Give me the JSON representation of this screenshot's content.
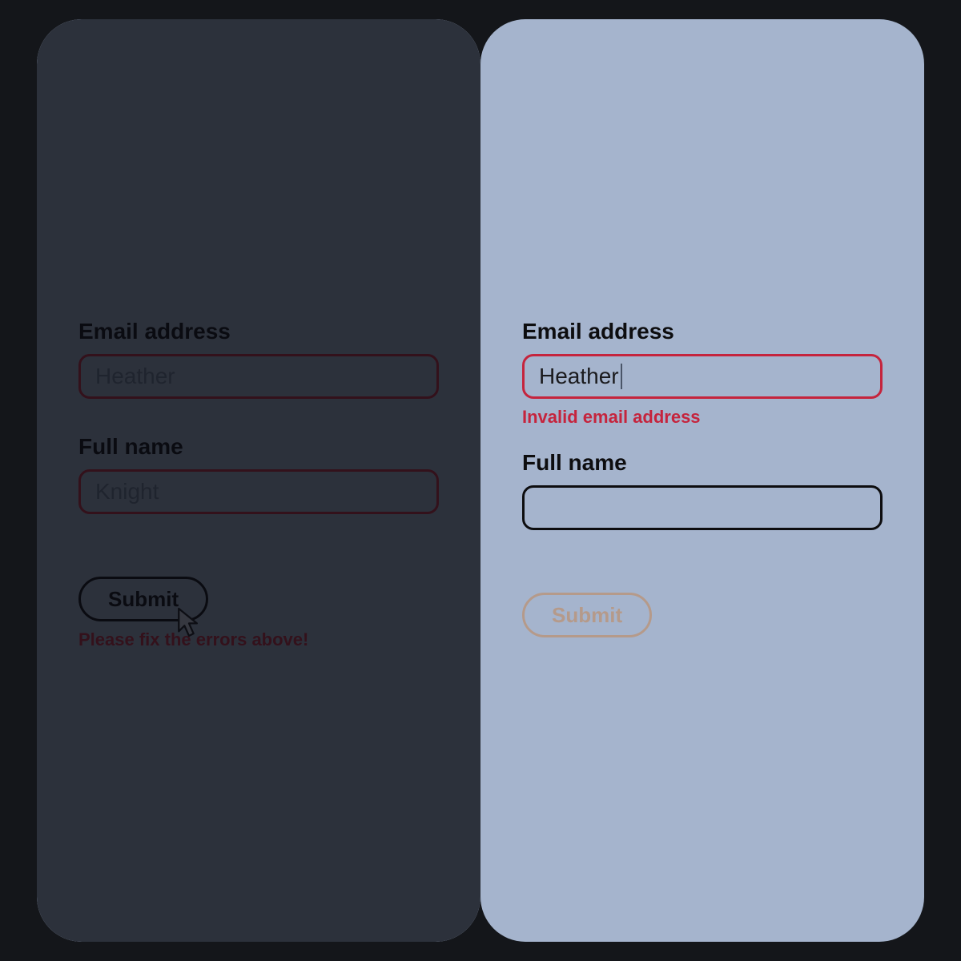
{
  "left": {
    "email_label": "Email address",
    "email_value": "Heather",
    "name_label": "Full name",
    "name_value": "Knight",
    "submit_label": "Submit",
    "submit_error": "Please fix the errors above!"
  },
  "right": {
    "email_label": "Email address",
    "email_value": "Heather",
    "email_error": "Invalid email address",
    "name_label": "Full name",
    "name_value": "",
    "submit_label": "Submit"
  },
  "colors": {
    "error": "#c5243d",
    "panel": "#a5b4cd",
    "bg": "#14161a"
  }
}
